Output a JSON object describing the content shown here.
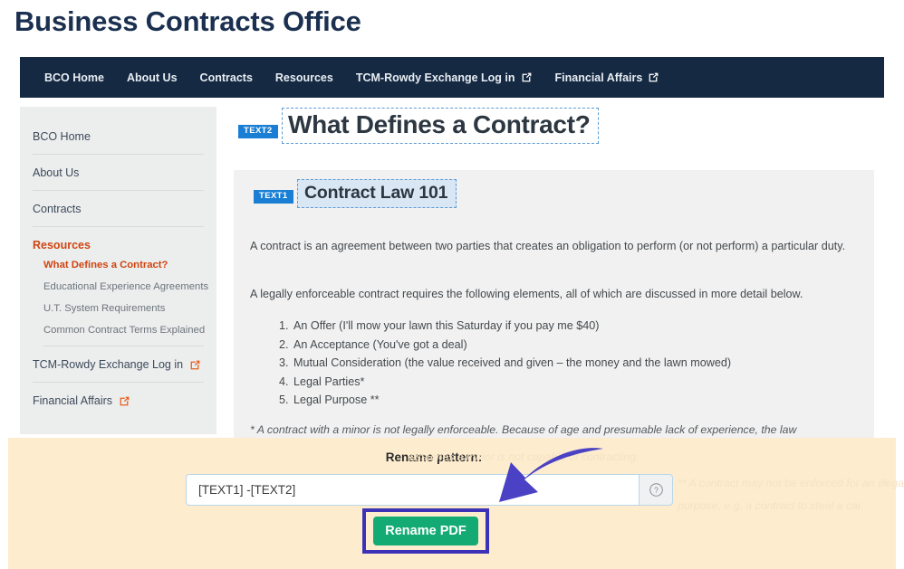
{
  "site": {
    "title": "Business Contracts Office"
  },
  "topnav": {
    "items": [
      {
        "label": "BCO Home",
        "external": false
      },
      {
        "label": "About Us",
        "external": false
      },
      {
        "label": "Contracts",
        "external": false
      },
      {
        "label": "Resources",
        "external": false
      },
      {
        "label": "TCM-Rowdy Exchange Log in",
        "external": true
      },
      {
        "label": "Financial Affairs",
        "external": true
      }
    ]
  },
  "sidebar": {
    "items": [
      {
        "label": "BCO Home",
        "external": false,
        "active": false
      },
      {
        "label": "About Us",
        "external": false,
        "active": false
      },
      {
        "label": "Contracts",
        "external": false,
        "active": false
      },
      {
        "label": "Resources",
        "external": false,
        "active": true
      }
    ],
    "sub_items": [
      {
        "label": "What Defines a Contract?",
        "active": true
      },
      {
        "label": "Educational Experience Agreements",
        "active": false
      },
      {
        "label": "U.T. System Requirements",
        "active": false
      },
      {
        "label": "Common Contract Terms Explained",
        "active": false
      }
    ],
    "bottom_items": [
      {
        "label": "TCM-Rowdy Exchange Log in",
        "external": true
      },
      {
        "label": "Financial Affairs",
        "external": true
      }
    ]
  },
  "main": {
    "text2_badge": "TEXT2",
    "heading": "What Defines a Contract?",
    "text1_badge": "TEXT1",
    "sub_heading": "Contract Law 101",
    "paragraph1": "A contract is an agreement between two parties that creates an obligation to perform (or not perform) a particular duty.",
    "paragraph2": "A legally enforceable contract requires the following elements, all of which are discussed in more detail below.",
    "list_items": [
      "An Offer (I'll mow your lawn this Saturday if you pay me $40)",
      "An Acceptance (You've got a deal)",
      "Mutual Consideration (the value received and given – the money and the lawn mowed)",
      "Legal Parties*",
      "Legal Purpose **"
    ],
    "footnote": "* A contract with a minor is not legally enforceable. Because of age and presumable lack of experience, the law",
    "ghost_lines": [
      "assumes a minor is not capable of contracting.",
      "** A contract may not be enforced for an illegal",
      "purpose, e.g. a contract to steal a car."
    ]
  },
  "overlay": {
    "rename_label": "Rename pattern:",
    "input_value": "[TEXT1] -[TEXT2]",
    "input_placeholder": "",
    "help_icon": "question-mark-icon",
    "button_label": "Rename PDF"
  },
  "colors": {
    "nav_bar": "#152942",
    "title": "#1b3050",
    "sidebar_bg": "#eceded",
    "accent_orange": "#cf4511",
    "badge_blue": "#1a7fd4",
    "overlay_bg": "#fdecce",
    "button_green": "#13ab73",
    "highlight_purple": "#3b32b8"
  }
}
